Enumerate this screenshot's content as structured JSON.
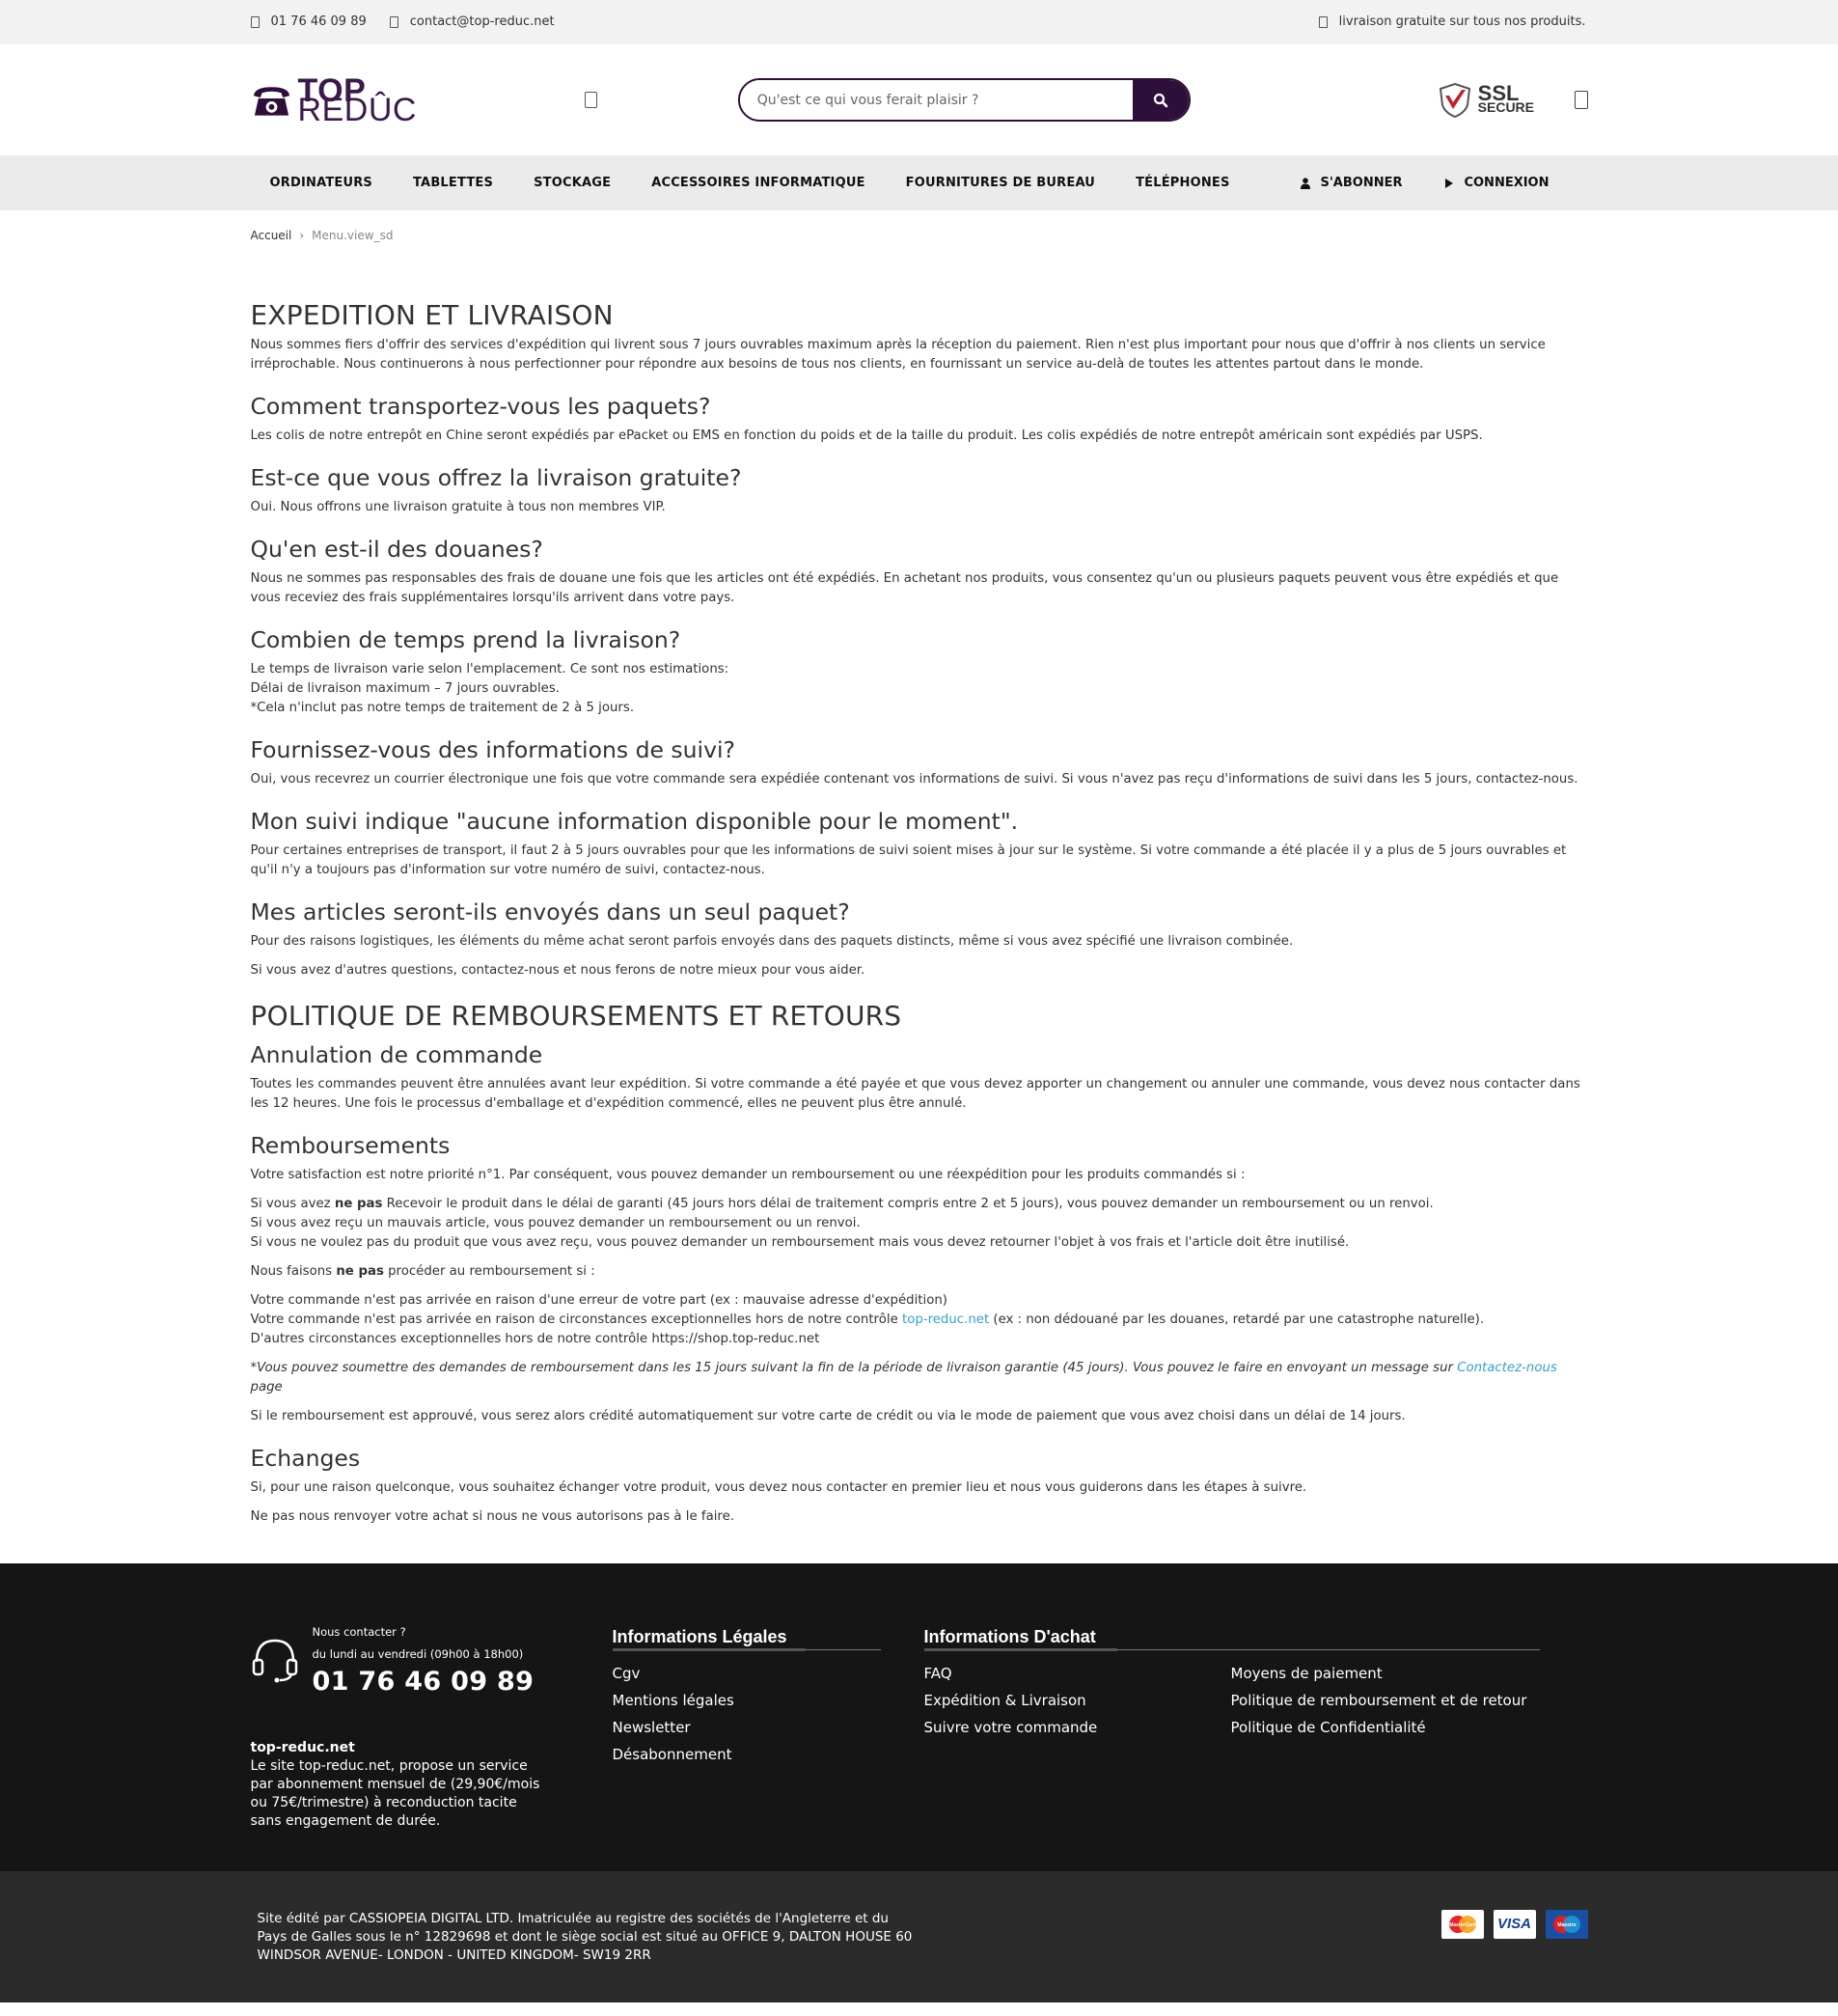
{
  "topbar": {
    "phone": "01 76 46 09 89",
    "email": "contact@top-reduc.net",
    "promo": "livraison gratuite sur tous nos produits."
  },
  "header": {
    "logo_bold": "TOP",
    "logo_light": "REDÛC",
    "search_placeholder": "Qu'est ce qui vous ferait plaisir ?",
    "ssl_line1": "SSL",
    "ssl_line2": "SECURE"
  },
  "nav": {
    "items": [
      "ORDINATEURS",
      "TABLETTES",
      "STOCKAGE",
      "ACCESSOIRES INFORMATIQUE",
      "FOURNITURES DE BUREAU",
      "TÉLÉPHONES"
    ],
    "subscribe": "S'ABONNER",
    "login": "CONNEXION"
  },
  "breadcrumb": {
    "home": "Accueil",
    "current": "Menu.view_sd"
  },
  "content": {
    "h1_shipping": "EXPEDITION ET LIVRAISON",
    "p_intro": "Nous sommes fiers d'offrir des services d'expédition qui livrent sous 7 jours ouvrables maximum après la réception du paiement. Rien n'est plus important pour nous que d'offrir à nos clients un service irréprochable. Nous continuerons à nous perfectionner pour répondre aux besoins de tous nos clients, en fournissant un service au-delà de toutes les attentes partout dans le monde.",
    "h2_transport": "Comment transportez-vous les paquets?",
    "p_transport": "Les colis de notre entrepôt en Chine seront expédiés par ePacket ou EMS en fonction du poids et de la taille du produit. Les colis expédiés de notre entrepôt américain sont expédiés par USPS.",
    "h2_free": "Est-ce que vous offrez la livraison gratuite?",
    "p_free": "Oui. Nous offrons une livraison gratuite à tous non membres VIP.",
    "h2_customs": "Qu'en est-il des douanes?",
    "p_customs": "Nous ne sommes pas responsables des frais de douane une fois que les articles ont été expédiés. En achetant nos produits, vous consentez qu'un ou plusieurs paquets peuvent vous être expédiés et que vous receviez des frais supplémentaires lorsqu'ils arrivent dans votre pays.",
    "h2_time": "Combien de temps prend la livraison?",
    "p_time_1": "Le temps de livraison varie selon l'emplacement. Ce sont nos estimations:",
    "p_time_2": "Délai de livraison maximum – 7 jours ouvrables.",
    "p_time_3": "*Cela n'inclut pas notre temps de traitement de 2 à 5 jours.",
    "h2_tracking": "Fournissez-vous des informations de suivi?",
    "p_tracking": "Oui, vous recevrez un courrier électronique une fois que votre commande sera expédiée contenant vos informations de suivi. Si vous n'avez pas reçu d'informations de suivi dans les 5 jours, contactez-nous.",
    "h2_noinfo": "Mon suivi indique \"aucune information disponible pour le moment\".",
    "p_noinfo": "Pour certaines entreprises de transport, il faut 2 à 5 jours ouvrables pour que les informations de suivi soient mises à jour sur le système. Si votre commande a été placée il y a plus de 5 jours ouvrables et qu'il n'y a toujours pas d'information sur votre numéro de suivi, contactez-nous.",
    "h2_onepackage": "Mes articles seront-ils envoyés dans un seul paquet?",
    "p_onepackage": "Pour des raisons logistiques, les éléments du même achat seront parfois envoyés dans des paquets distincts, même si vous avez spécifié une livraison combinée.",
    "p_questions": "Si vous avez d'autres questions, contactez-nous et nous ferons de notre mieux pour vous aider.",
    "h1_refund": "POLITIQUE DE REMBOURSEMENTS ET RETOURS",
    "h2_cancel": "Annulation de commande",
    "p_cancel": "Toutes les commandes peuvent être annulées avant leur expédition. Si votre commande a été payée et que vous devez apporter un changement ou annuler une commande, vous devez nous contacter dans les 12 heures. Une fois le processus d'emballage et d'expédition commencé, elles ne peuvent plus être annulé.",
    "h2_refunds": "Remboursements",
    "p_refunds": "Votre satisfaction est notre priorité n°1. Par conséquent, vous pouvez demander un remboursement ou une réexpédition pour les produits commandés si :",
    "r1_a": "Si vous avez ",
    "r1_b": "ne pas",
    "r1_c": " Recevoir le produit dans le délai de garanti (45 jours hors délai de traitement compris entre 2 et 5 jours), vous pouvez demander un remboursement ou un renvoi.",
    "r2": "Si vous avez reçu un mauvais article, vous pouvez demander un remboursement ou un renvoi.",
    "r3": "Si vous ne voulez pas du produit que vous avez reçu, vous pouvez demander un remboursement mais vous devez retourner l'objet à vos frais et l'article doit être inutilisé.",
    "n_a": "Nous faisons ",
    "n_b": "ne pas",
    "n_c": " procéder au remboursement si :",
    "x1": "Votre commande n'est pas arrivée en raison d'une erreur de votre part (ex : mauvaise adresse d'expédition)",
    "x2_a": "Votre commande n'est pas arrivée en raison de circonstances exceptionnelles hors de notre contrôle ",
    "x2_link": "top-reduc.net",
    "x2_b": " (ex : non dédouané par les douanes, retardé par une catastrophe naturelle).",
    "x3": "D'autres circonstances exceptionnelles hors de notre contrôle https://shop.top-reduc.net",
    "note_a": "*Vous pouvez soumettre des demandes de remboursement dans les 15 jours suivant la fin de la période de livraison garantie (45 jours). Vous pouvez le faire en envoyant un message sur ",
    "note_link": "Contactez-nous",
    "note_b": " page",
    "p_approved": "Si le remboursement est approuvé, vous serez alors crédité automatiquement sur votre carte de crédit ou via le mode de paiement que vous avez choisi dans un délai de 14 jours.",
    "h2_exchange": "Echanges",
    "p_exchange": "Si, pour une raison quelconque, vous souhaitez échanger votre produit, vous devez nous contacter en premier lieu et nous vous guiderons dans les étapes à suivre.",
    "p_noreturn": "Ne pas nous renvoyer votre achat si nous ne vous autorisons pas à le faire."
  },
  "footer": {
    "contact_label": "Nous contacter ?",
    "hours": "du lundi au vendredi (09h00 à 18h00)",
    "phone": "01 76 46 09 89",
    "site_name": "top-reduc.net",
    "site_desc": "Le site top-reduc.net, propose un service par abonnement mensuel de (29,90€/mois ou 75€/trimestre) à reconduction tacite sans engagement de durée.",
    "col1_title": "Informations Légales",
    "col1_links": [
      "Cgv",
      "Mentions légales",
      "Newsletter",
      "Désabonnement"
    ],
    "col2_title": "Informations D'achat",
    "col2_links": [
      "FAQ",
      "Moyens de paiement",
      "Expédition & Livraison",
      "Politique de remboursement et de retour",
      "Suivre votre commande",
      "Politique de Confidentialité"
    ]
  },
  "legal": {
    "text": "Site édité par CASSIOPEIA DIGITAL LTD. Imatriculée au registre des sociétés de l'Angleterre et du Pays de Galles sous le n° 12829698 et dont le siège social est situé au OFFICE 9, DALTON HOUSE 60 WINDSOR AVENUE- LONDON - UNITED KINGDOM- SW19 2RR",
    "cards": [
      "MasterCard",
      "VISA",
      "Maestro"
    ]
  },
  "colors": {
    "brand": "#2d0f3a",
    "link": "#3aa0c8",
    "footer_bg": "#151515",
    "legal_bg": "#2b2b2b"
  }
}
